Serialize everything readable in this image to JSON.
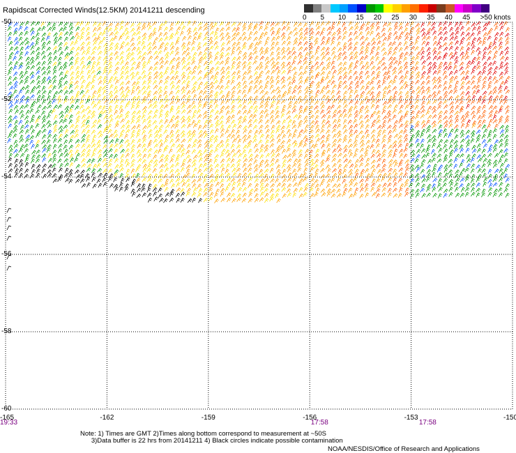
{
  "title": "Rapidscat Corrected Winds(12.5KM) 20141211 descending",
  "legend": {
    "colors": [
      "#303030",
      "#808080",
      "#c8c8c8",
      "#00c8ff",
      "#00a0ff",
      "#0050ff",
      "#0000c8",
      "#009600",
      "#00c800",
      "#ffff00",
      "#ffd000",
      "#ffa000",
      "#ff7000",
      "#ff2000",
      "#c80000",
      "#783c1e",
      "#c85a28",
      "#ff00ff",
      "#c800c8",
      "#8000c8",
      "#400080"
    ],
    "labels": [
      {
        "text": "0",
        "value": 0
      },
      {
        "text": "5",
        "value": 5
      },
      {
        "text": "10",
        "value": 10
      },
      {
        "text": "15",
        "value": 15
      },
      {
        "text": "20",
        "value": 20
      },
      {
        "text": "25",
        "value": 25
      },
      {
        "text": "30",
        "value": 30
      },
      {
        "text": "35",
        "value": 35
      },
      {
        "text": "40",
        "value": 40
      },
      {
        "text": "45",
        "value": 45
      },
      {
        "text": ">50 knots",
        "value": 50
      }
    ]
  },
  "latitude_labels": [
    "-50",
    "-52",
    "-54",
    "-56",
    "-58",
    "-60"
  ],
  "longitude_labels": [
    "-165",
    "-162",
    "-159",
    "-156",
    "-153",
    "-150"
  ],
  "time_labels": [
    {
      "text": "19:33",
      "lon": -165
    },
    {
      "text": "17:58",
      "lon": -155.7
    },
    {
      "text": "17:58",
      "lon": -152.5
    }
  ],
  "notes": "Note: 1) Times are GMT 2)Times along bottom correspond to measurement at ~50S\n      3)Data buffer is 22 hrs from 20141211 4) Black circles indicate possible contamination",
  "credit": "NOAA/NESDIS/Office of Research and Applications",
  "map_extent": {
    "lon_min": -165,
    "lon_max": -150,
    "lat_min": -60,
    "lat_max": -50
  }
}
